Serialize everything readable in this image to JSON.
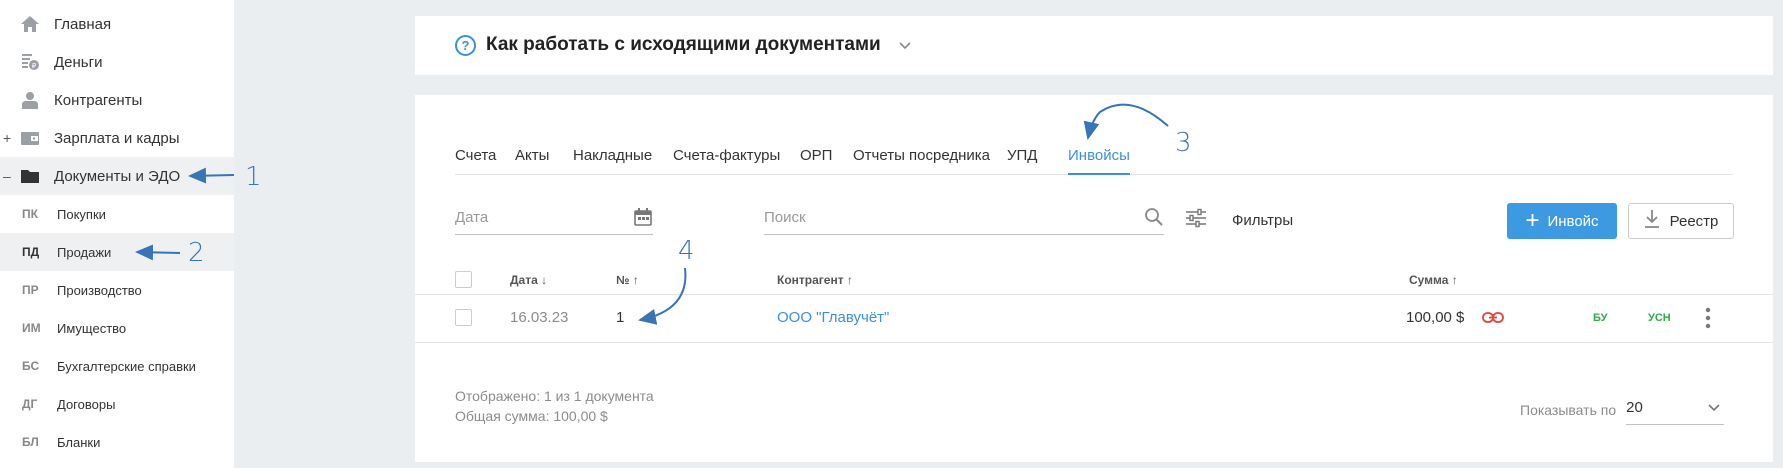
{
  "sidebar": {
    "items": [
      {
        "label": "Главная",
        "icon": "home-icon"
      },
      {
        "label": "Деньги",
        "icon": "money-icon"
      },
      {
        "label": "Контрагенты",
        "icon": "contractors-icon"
      },
      {
        "label": "Зарплата и кадры",
        "icon": "wallet-icon",
        "prefix": "+"
      },
      {
        "label": "Документы и ЭДО",
        "icon": "folder-icon",
        "prefix": "–"
      }
    ],
    "subitems": [
      {
        "abbr": "ПК",
        "label": "Покупки"
      },
      {
        "abbr": "ПД",
        "label": "Продажи"
      },
      {
        "abbr": "ПР",
        "label": "Производство"
      },
      {
        "abbr": "ИМ",
        "label": "Имущество"
      },
      {
        "abbr": "БС",
        "label": "Бухгалтерские справки"
      },
      {
        "abbr": "ДГ",
        "label": "Договоры"
      },
      {
        "abbr": "БЛ",
        "label": "Бланки"
      }
    ]
  },
  "help": {
    "icon_text": "?",
    "title": "Как работать с исходящими документами"
  },
  "tabs": [
    "Счета",
    "Акты",
    "Накладные",
    "Счета-фактуры",
    "ОРП",
    "Отчеты посредника",
    "УПД",
    "Инвойсы"
  ],
  "filters": {
    "date_placeholder": "Дата",
    "search_placeholder": "Поиск",
    "filters_label": "Фильтры"
  },
  "buttons": {
    "add_plus": "+",
    "add_label": "Инвойс",
    "registry_label": "Реестр"
  },
  "table": {
    "headers": {
      "date": "Дата ↓",
      "number": "№ ↑",
      "contractor": "Контрагент ↑",
      "sum": "Сумма ↑"
    },
    "rows": [
      {
        "date": "16.03.23",
        "number": "1",
        "contractor": "ООО \"Главучёт\"",
        "sum": "100,00 $",
        "tag1": "БУ",
        "tag2": "УСН"
      }
    ]
  },
  "footer": {
    "shown": "Отображено: 1 из 1 документа",
    "total": "Общая сумма: 100,00 $",
    "page_size_label": "Показывать по",
    "page_size": "20"
  },
  "annotations": [
    "1",
    "2",
    "3",
    "4"
  ],
  "colors": {
    "accent": "#3d8fd9",
    "button": "#3d9ae0",
    "tag": "#2eaa4a",
    "link_icon": "#e0463a",
    "annotation": "#3a74b6"
  }
}
